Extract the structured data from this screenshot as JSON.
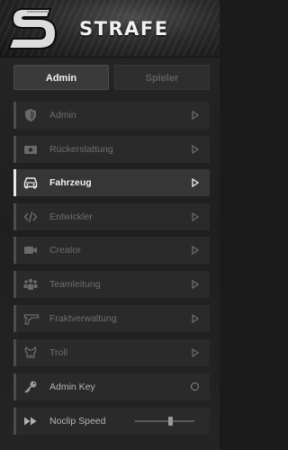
{
  "brand": {
    "name": "STRAFE"
  },
  "tabs": [
    {
      "label": "Admin",
      "active": true
    },
    {
      "label": "Spieler",
      "active": false
    }
  ],
  "menu": [
    {
      "label": "Admin",
      "icon": "shield-icon",
      "control": "arrow",
      "selected": false
    },
    {
      "label": "Rückerstattung",
      "icon": "money-icon",
      "control": "arrow",
      "selected": false
    },
    {
      "label": "Fahrzeug",
      "icon": "car-icon",
      "control": "arrow",
      "selected": true
    },
    {
      "label": "Entwickler",
      "icon": "code-icon",
      "control": "arrow",
      "selected": false
    },
    {
      "label": "Creator",
      "icon": "video-camera-icon",
      "control": "arrow",
      "selected": false
    },
    {
      "label": "Teamleitung",
      "icon": "team-icon",
      "control": "arrow",
      "selected": false
    },
    {
      "label": "Fraktverwaltung",
      "icon": "gun-icon",
      "control": "arrow",
      "selected": false
    },
    {
      "label": "Troll",
      "icon": "troll-icon",
      "control": "arrow",
      "selected": false
    },
    {
      "label": "Admin Key",
      "icon": "key-icon",
      "control": "radio",
      "selected": false
    },
    {
      "label": "Noclip Speed",
      "icon": "fast-forward-icon",
      "control": "slider",
      "selected": false,
      "slider_value": 0.6
    }
  ],
  "colors": {
    "accent": "#e8e8e8",
    "muted": "#6e6e6e",
    "background": "#242424"
  }
}
